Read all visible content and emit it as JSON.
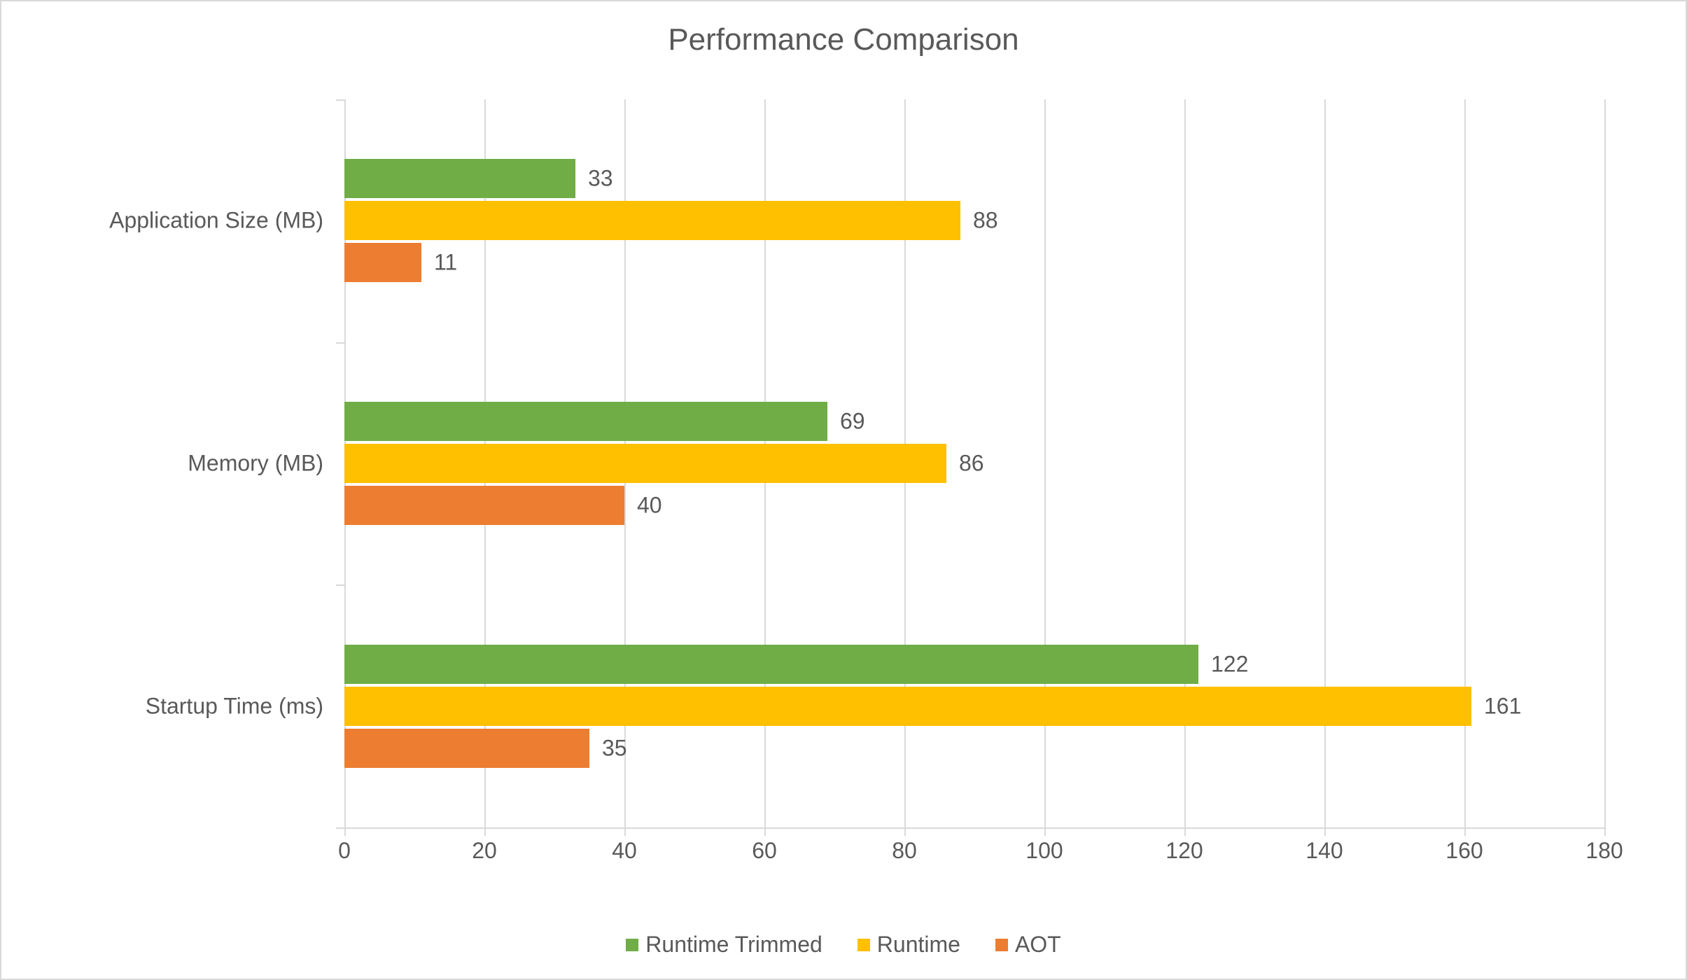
{
  "chart_data": {
    "type": "bar",
    "orientation": "horizontal",
    "title": "Performance Comparison",
    "categories": [
      "Startup Time (ms)",
      "Memory (MB)",
      "Application Size (MB)"
    ],
    "series": [
      {
        "name": "AOT",
        "values": [
          35,
          40,
          11
        ],
        "color": "#ED7D31"
      },
      {
        "name": "Runtime",
        "values": [
          161,
          86,
          88
        ],
        "color": "#FFC000"
      },
      {
        "name": "Runtime Trimmed",
        "values": [
          122,
          69,
          33
        ],
        "color": "#70AD47"
      }
    ],
    "xlim": [
      0,
      180
    ],
    "xticks": [
      0,
      20,
      40,
      60,
      80,
      100,
      120,
      140,
      160,
      180
    ],
    "legend_order": [
      "Runtime Trimmed",
      "Runtime",
      "AOT"
    ],
    "xlabel": "",
    "ylabel": ""
  }
}
